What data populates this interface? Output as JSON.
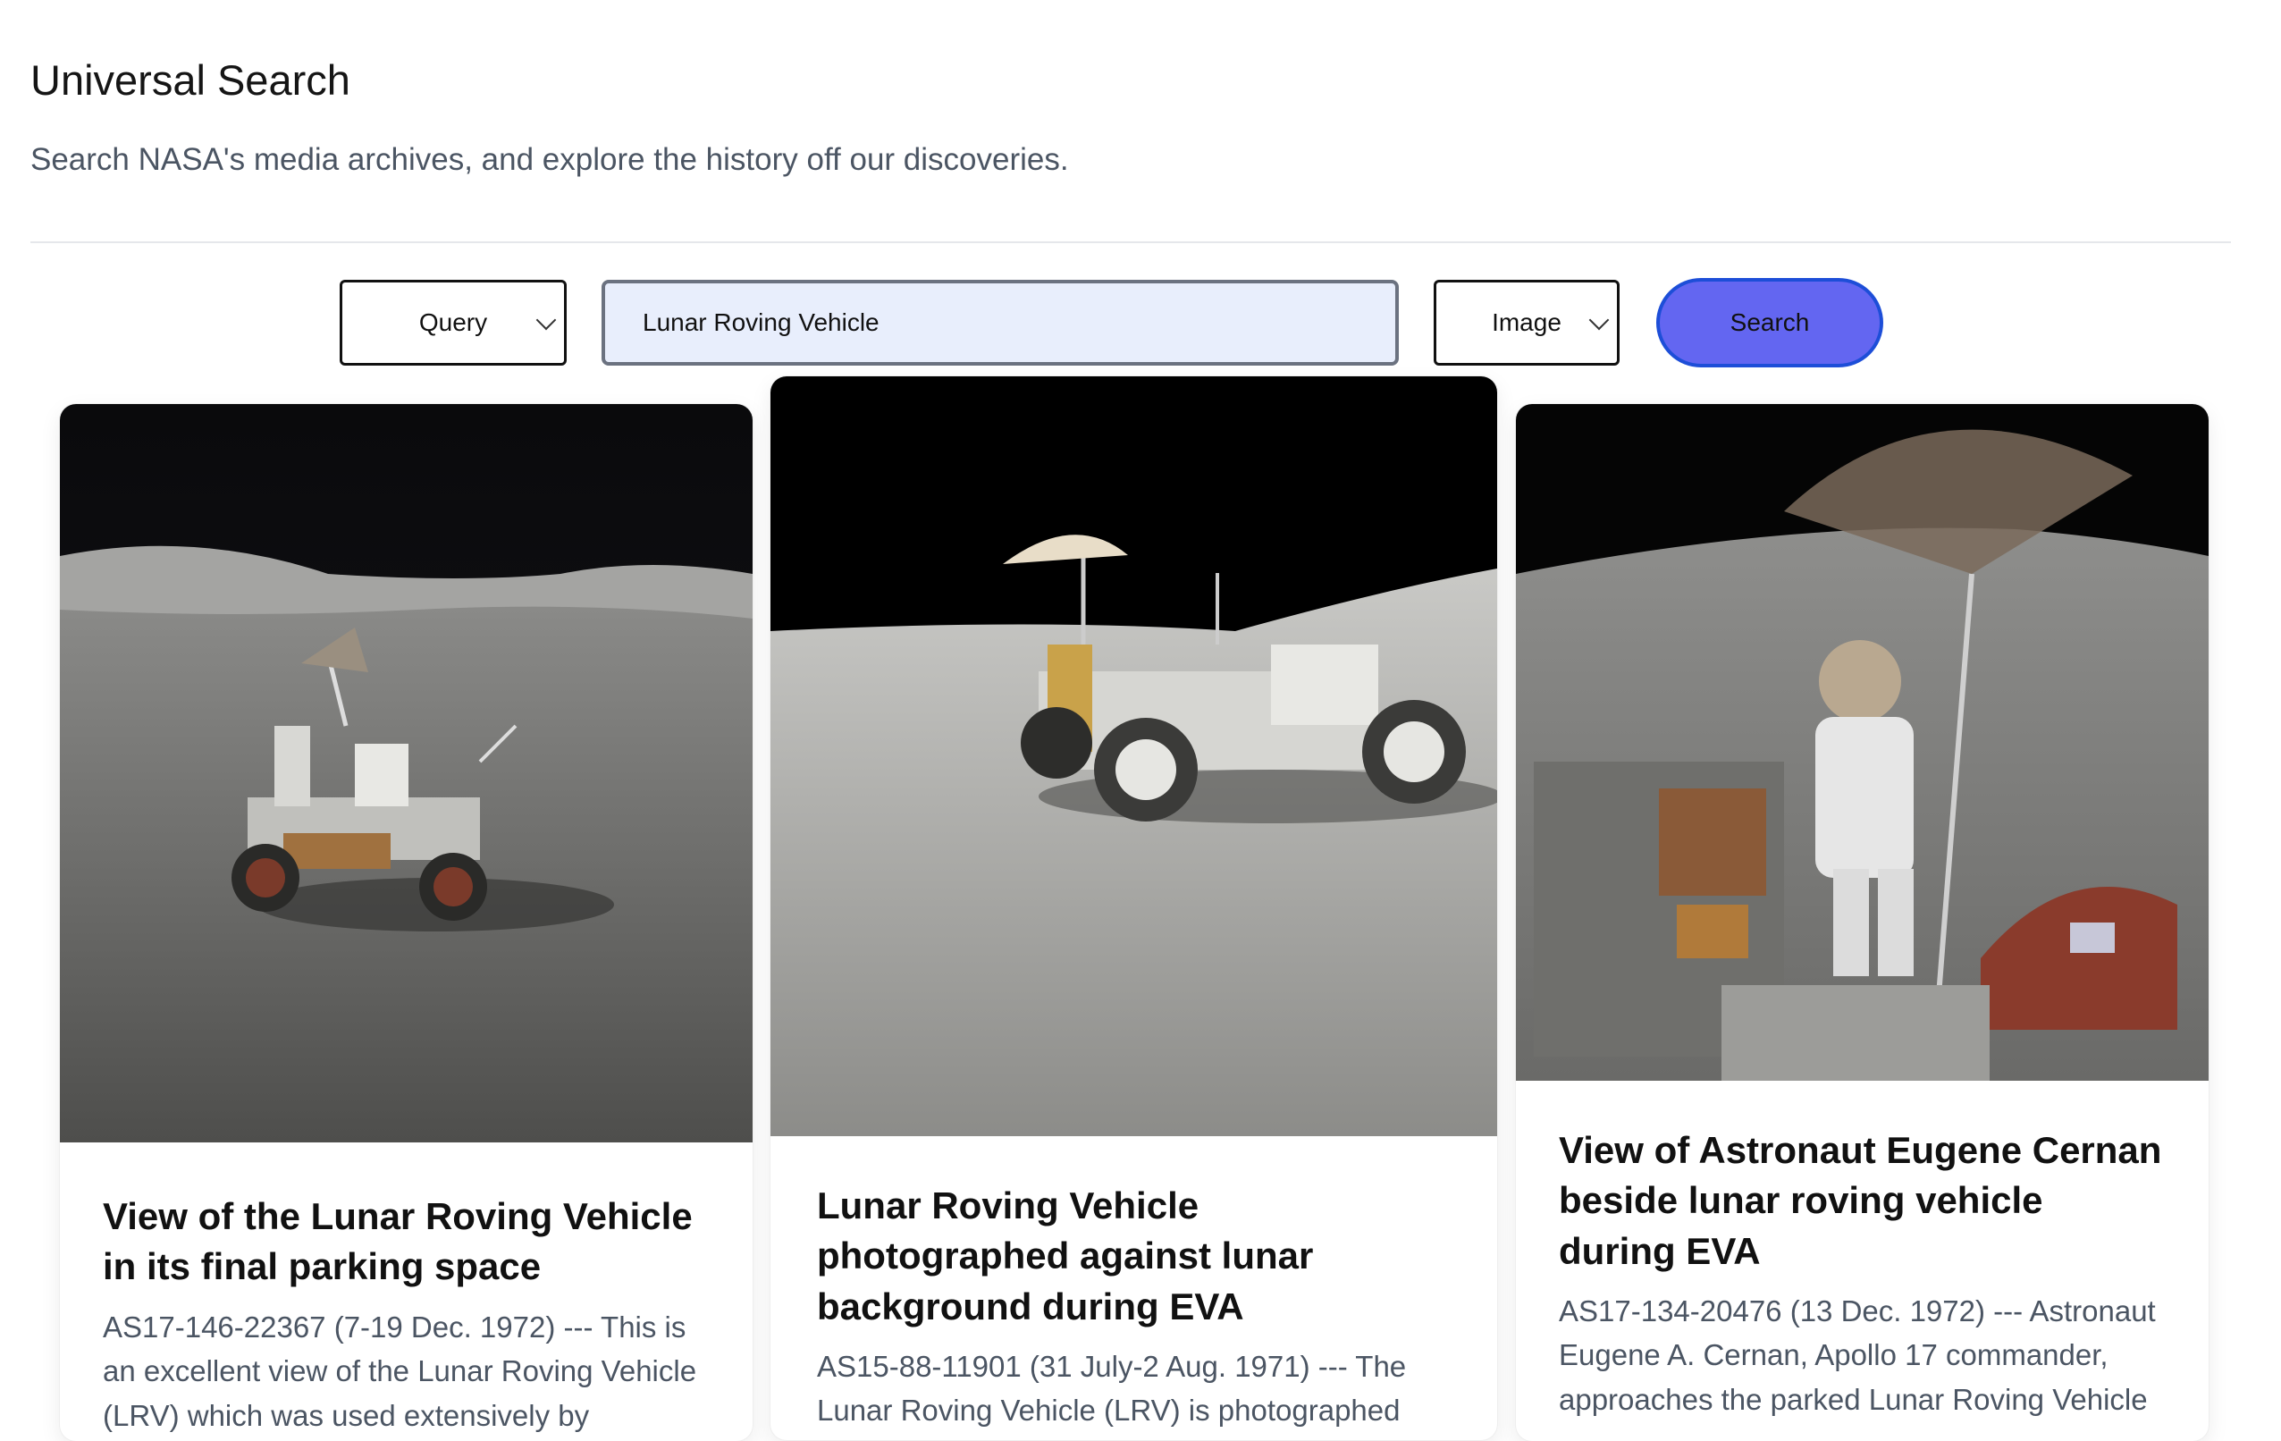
{
  "header": {
    "title": "Universal Search",
    "subtitle": "Search NASA's media archives, and explore the history off our discoveries."
  },
  "search": {
    "field_select": "Query",
    "query_value": "Lunar Roving Vehicle",
    "media_select": "Image",
    "button_label": "Search"
  },
  "results": [
    {
      "title": "View of the Lunar Roving Vehicle in its final parking space",
      "description": "AS17-146-22367 (7-19 Dec. 1972) --- This is an excellent view of the Lunar Roving Vehicle (LRV) which was used extensively by"
    },
    {
      "title": "Lunar Roving Vehicle photographed against lunar background during EVA",
      "description": "AS15-88-11901 (31 July-2 Aug. 1971) --- The Lunar Roving Vehicle (LRV) is photographed alone against the desolate lunar background"
    },
    {
      "title": "View of Astronaut Eugene Cernan beside lunar roving vehicle during EVA",
      "description": "AS17-134-20476 (13 Dec. 1972) --- Astronaut Eugene A. Cernan, Apollo 17 commander, approaches the parked Lunar Roving Vehicle"
    }
  ],
  "colors": {
    "accent": "#6366f1",
    "input_bg": "#e8eefc"
  }
}
